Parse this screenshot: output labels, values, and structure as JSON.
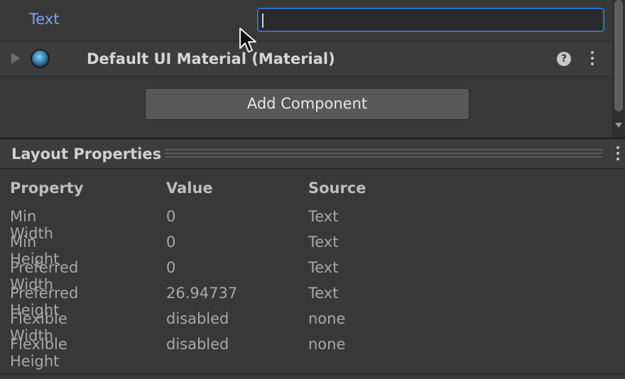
{
  "text_field": {
    "label": "Text",
    "value": ""
  },
  "material": {
    "title": "Default UI Material (Material)",
    "help_glyph": "?"
  },
  "add_component": {
    "label": "Add Component"
  },
  "layout_properties": {
    "title": "Layout Properties",
    "columns": [
      "Property",
      "Value",
      "Source"
    ],
    "rows": [
      [
        "Min Width",
        "0",
        "Text"
      ],
      [
        "Min Height",
        "0",
        "Text"
      ],
      [
        "Preferred Width",
        "0",
        "Text"
      ],
      [
        "Preferred Height",
        "26.94737",
        "Text"
      ],
      [
        "Flexible Width",
        "disabled",
        "none"
      ],
      [
        "Flexible Height",
        "disabled",
        "none"
      ]
    ]
  },
  "icons": {
    "foldout": "triangle-right-icon",
    "material": "material-sphere-icon",
    "help": "help-icon",
    "menu": "kebab-menu-icon",
    "cursor": "mouse-pointer-icon"
  },
  "colors": {
    "accent": "#3a7be0",
    "label_blue": "#7ba4ee",
    "background": "#383838"
  }
}
